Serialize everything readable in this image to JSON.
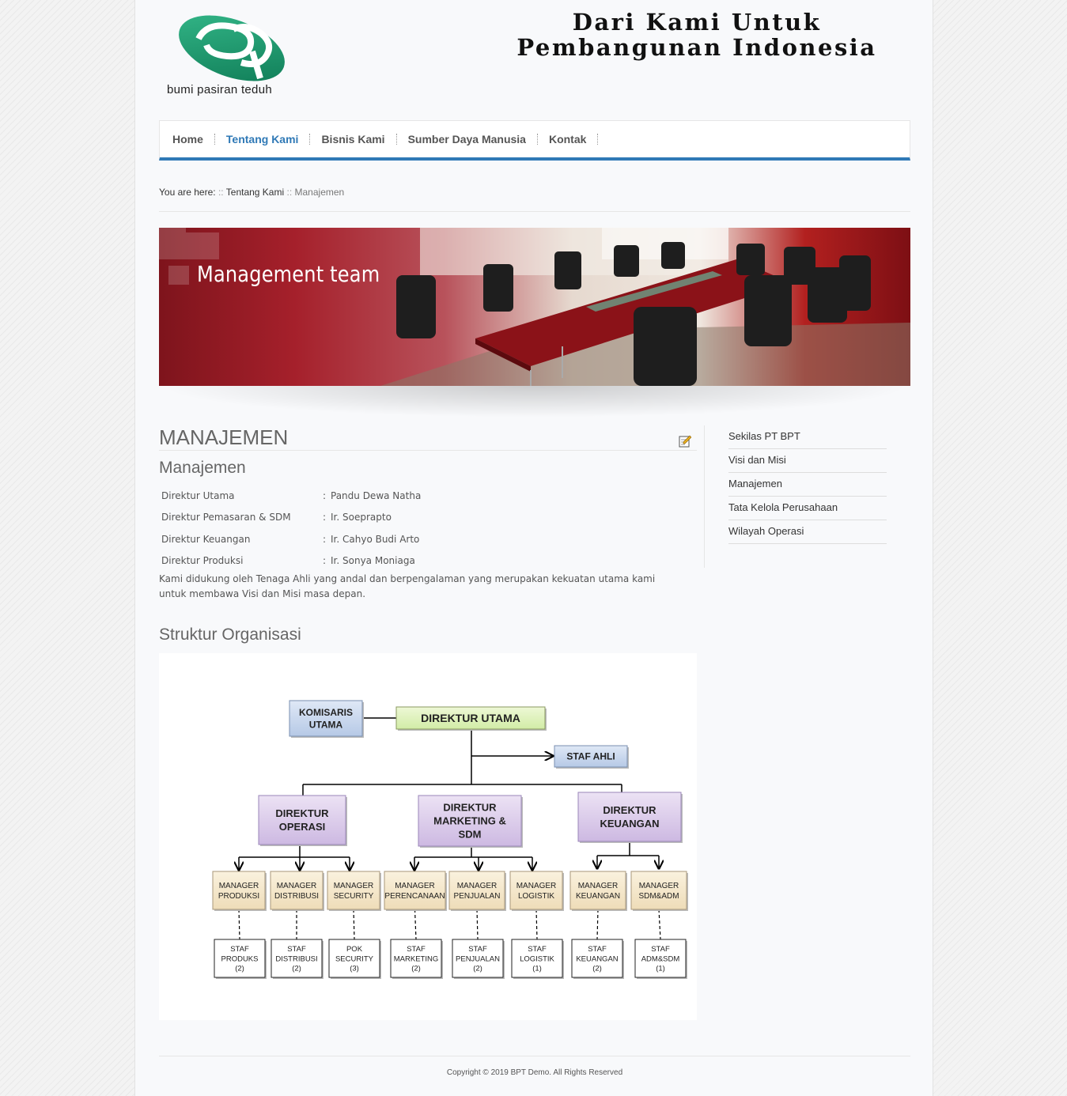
{
  "header": {
    "logo_text": "bumi pasiran teduh",
    "slogan_line1": "Dari Kami Untuk",
    "slogan_line2": "Pembangunan Indonesia"
  },
  "nav": {
    "items": [
      {
        "label": "Home",
        "active": false
      },
      {
        "label": "Tentang Kami",
        "active": true
      },
      {
        "label": "Bisnis Kami",
        "active": false
      },
      {
        "label": "Sumber Daya Manusia",
        "active": false
      },
      {
        "label": "Kontak",
        "active": false
      }
    ],
    "accent_color": "#2f79b6"
  },
  "breadcrumb": {
    "prefix": "You are here:",
    "sep": "::",
    "parent": "Tentang Kami",
    "current": "Manajemen"
  },
  "banner": {
    "title": "Management team"
  },
  "main": {
    "title": "MANAJEMEN",
    "subtitle": "Manajemen",
    "board": [
      {
        "role": "Direktur Utama",
        "colon": ":",
        "name": "Pandu Dewa Natha"
      },
      {
        "role": "Direktur Pemasaran & SDM",
        "colon": ":",
        "name": "Ir. Soeprapto"
      },
      {
        "role": "Direktur Keuangan",
        "colon": ":",
        "name": "Ir. Cahyo Budi Arto"
      },
      {
        "role": "Direktur Produksi",
        "colon": ":",
        "name": "Ir. Sonya Moniaga"
      }
    ],
    "paragraph": "Kami didukung oleh Tenaga Ahli yang andal dan berpengalaman yang merupakan kekuatan utama kami untuk membawa Visi dan Misi masa depan.",
    "org_title": "Struktur Organisasi"
  },
  "org_chart": {
    "komisaris": [
      "KOMISARIS",
      "UTAMA"
    ],
    "direktur_utama": "DIREKTUR UTAMA",
    "staf_ahli": "STAF AHLI",
    "directors": [
      [
        "DIREKTUR",
        "OPERASI"
      ],
      [
        "DIREKTUR",
        "MARKETING &",
        "SDM"
      ],
      [
        "DIREKTUR",
        "KEUANGAN"
      ]
    ],
    "managers": [
      [
        "MANAGER",
        "PRODUKSI"
      ],
      [
        "MANAGER",
        "DISTRIBUSI"
      ],
      [
        "MANAGER",
        "SECURITY"
      ],
      [
        "MANAGER",
        "PERENCANAAN"
      ],
      [
        "MANAGER",
        "PENJUALAN"
      ],
      [
        "MANAGER",
        "LOGISTIK"
      ],
      [
        "MANAGER",
        "KEUANGAN"
      ],
      [
        "MANAGER",
        "SDM&ADM"
      ]
    ],
    "staff": [
      [
        "STAF",
        "PRODUKS",
        "(2)"
      ],
      [
        "STAF",
        "DISTRIBUSI",
        "(2)"
      ],
      [
        "POK",
        "SECURITY",
        "(3)"
      ],
      [
        "STAF",
        "MARKETING",
        "(2)"
      ],
      [
        "STAF",
        "PENJUALAN",
        "(2)"
      ],
      [
        "STAF",
        "LOGISTIK",
        "(1)"
      ],
      [
        "STAF",
        "KEUANGAN",
        "(2)"
      ],
      [
        "STAF",
        "ADM&SDM",
        "(1)"
      ]
    ]
  },
  "sidebar": {
    "items": [
      "Sekilas PT BPT",
      "Visi dan Misi",
      "Manajemen",
      "Tata Kelola Perusahaan",
      "Wilayah Operasi"
    ]
  },
  "footer": {
    "copyright": "Copyright © 2019 BPT Demo. All Rights Reserved"
  }
}
